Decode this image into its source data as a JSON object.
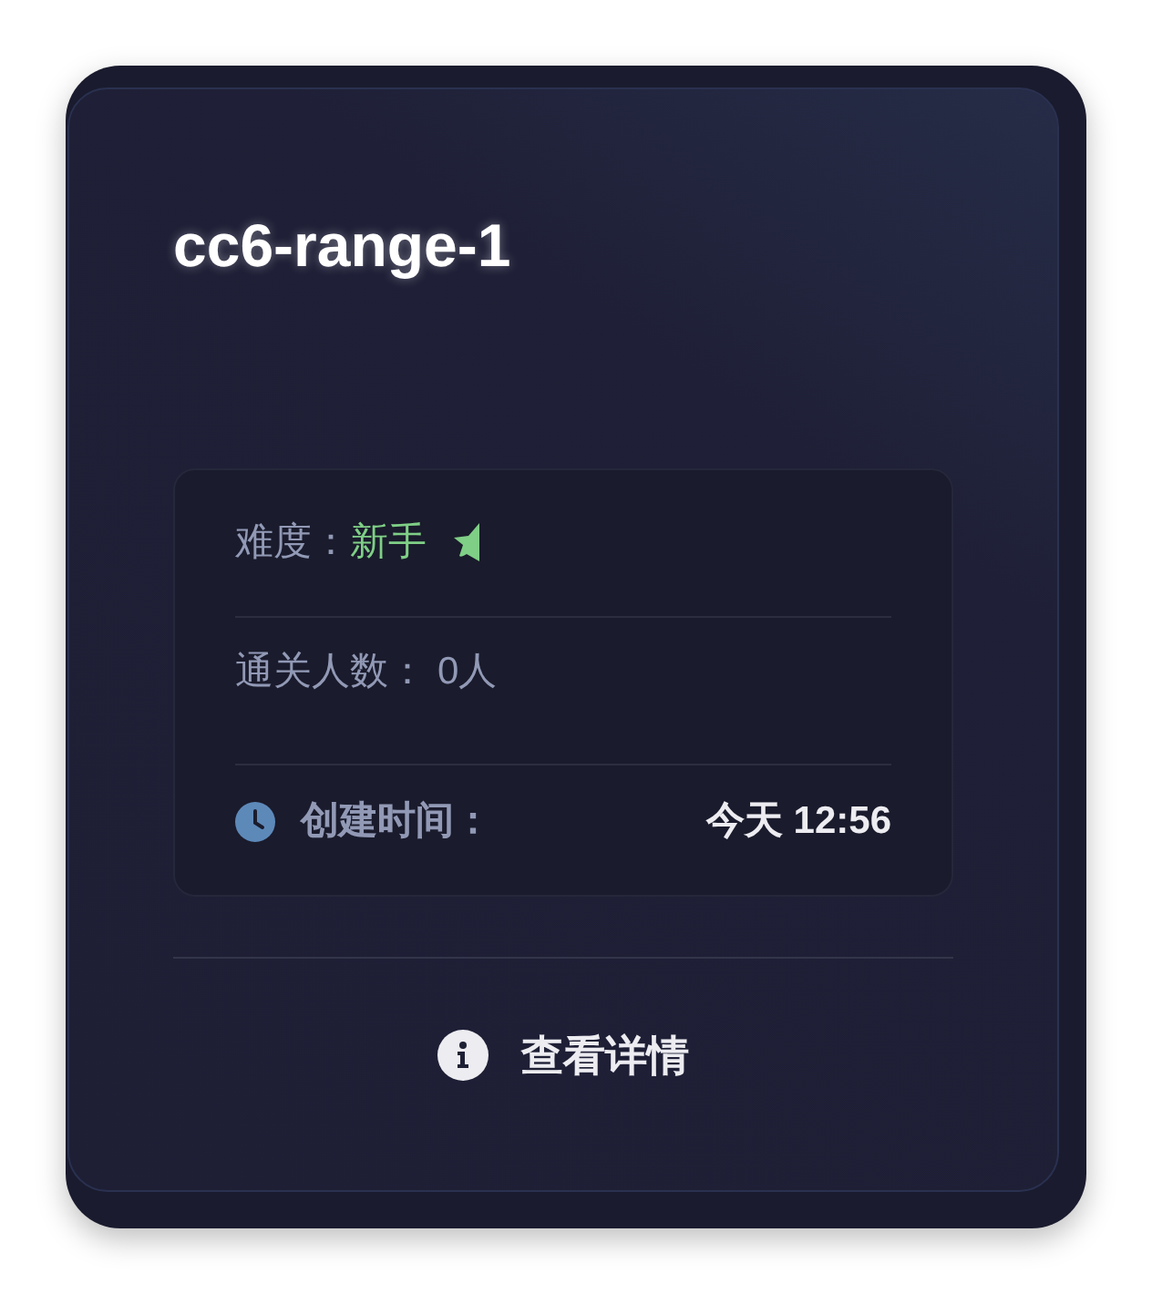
{
  "title": "cc6-range-1",
  "stats": [
    {
      "kind": "difficulty",
      "label": "难度：",
      "value": "新手"
    },
    {
      "kind": "count",
      "label": "通关人数：",
      "value": "0人"
    },
    {
      "kind": "time",
      "label": "创建时间：",
      "value": "今天 12:56"
    }
  ],
  "details_button": {
    "label": "查看详情"
  }
}
